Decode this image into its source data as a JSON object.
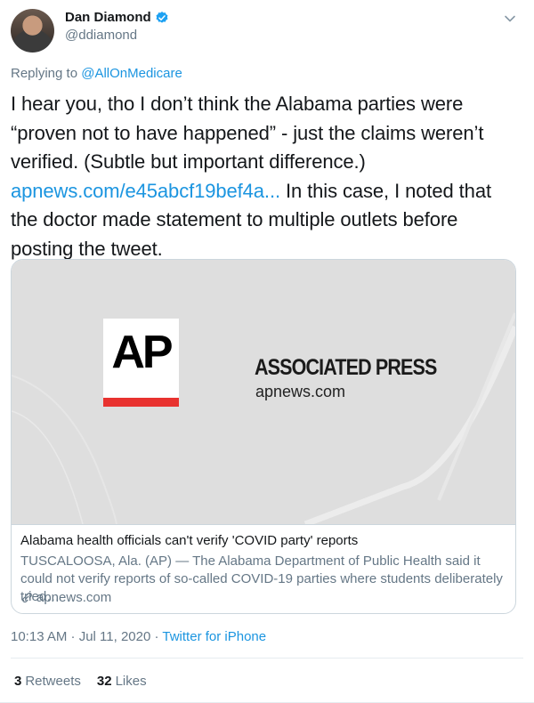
{
  "author": {
    "name": "Dan Diamond",
    "handle": "@ddiamond"
  },
  "reply": {
    "prefix": "Replying to ",
    "to": "@AllOnMedicare"
  },
  "body": {
    "text_before": "I hear you, tho I don’t think the Alabama parties were “proven not to have happened” - just the claims weren’t verified. (Subtle but important difference.) ",
    "link": "apnews.com/e45abcf19bef4a...",
    "text_after": " In this case, I noted that the doctor made statement to multiple outlets before posting the tweet."
  },
  "card": {
    "logo_text": "AP",
    "brand": "ASSOCIATED PRESS",
    "brand_domain": "apnews.com",
    "title": "Alabama health officials can't verify 'COVID party' reports",
    "description": "TUSCALOOSA, Ala. (AP) — The Alabama Department of Public Health said it could not verify reports of so-called COVID-19 parties where students deliberately tried…",
    "domain": "apnews.com"
  },
  "meta": {
    "time": "10:13 AM · Jul 11, 2020 · ",
    "source": "Twitter for iPhone"
  },
  "stats": {
    "retweets_count": "3",
    "retweets_label": "Retweets",
    "likes_count": "32",
    "likes_label": "Likes"
  },
  "colors": {
    "link": "#1b95e0",
    "secondary": "#657786",
    "ap_red": "#e8322f"
  }
}
